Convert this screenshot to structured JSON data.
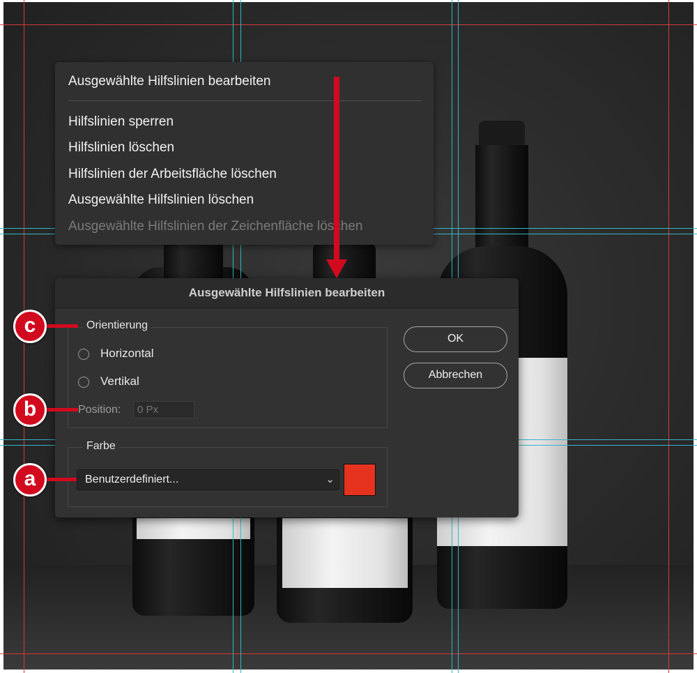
{
  "context_menu": {
    "items": [
      {
        "label": "Ausgewählte Hilfslinien bearbeiten",
        "enabled": true
      },
      {
        "label": "Hilfslinien sperren",
        "enabled": true
      },
      {
        "label": "Hilfslinien löschen",
        "enabled": true
      },
      {
        "label": "Hilfslinien der Arbeitsfläche löschen",
        "enabled": true
      },
      {
        "label": "Ausgewählte Hilfslinien löschen",
        "enabled": true
      },
      {
        "label": "Ausgewählte Hilfslinien der Zeichenfläche löschen",
        "enabled": false
      }
    ]
  },
  "dialog": {
    "title": "Ausgewählte Hilfslinien bearbeiten",
    "orientation": {
      "legend": "Orientierung",
      "options": [
        "Horizontal",
        "Vertikal"
      ],
      "position_label": "Position:",
      "position_placeholder": "0 Px"
    },
    "color": {
      "legend": "Farbe",
      "selected": "Benutzerdefiniert...",
      "swatch": "#e5331f"
    },
    "ok_label": "OK",
    "cancel_label": "Abbrechen"
  },
  "annotations": {
    "a": "a",
    "b": "b",
    "c": "c",
    "color": "#d20a1e"
  },
  "guide_colors": {
    "red": "#d83a3a",
    "cyan": "#31b8c6"
  }
}
